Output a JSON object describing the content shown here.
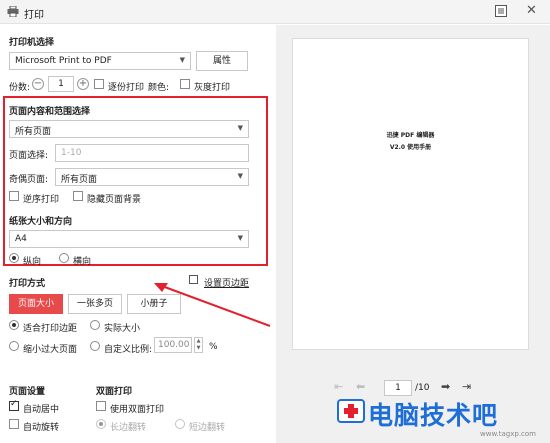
{
  "window": {
    "title": "打印"
  },
  "printer": {
    "section_title": "打印机选择",
    "selected": "Microsoft Print to PDF",
    "properties_label": "属性"
  },
  "copies": {
    "label": "份数:",
    "value": "1",
    "collate_label": "逐份打印",
    "color_label": "颜色:",
    "grayscale_label": "灰度打印"
  },
  "range": {
    "section_title": "页面内容和范围选择",
    "content_selected": "所有页面",
    "page_select_label": "页面选择:",
    "page_select_placeholder": "1-10",
    "odd_even_label": "奇偶页面:",
    "odd_even_selected": "所有页面",
    "reverse_label": "逆序打印",
    "hide_bg_label": "隐藏页面背景"
  },
  "paper": {
    "section_title": "纸张大小和方向",
    "size": "A4",
    "portrait_label": "纵向",
    "landscape_label": "横向"
  },
  "mode": {
    "section_title": "打印方式",
    "margin_link": "设置页边距",
    "tabs": [
      "页面大小",
      "一张多页",
      "小册子"
    ],
    "fit_label": "适合打印边距",
    "actual_label": "实际大小",
    "shrink_label": "缩小过大页面",
    "custom_label": "自定义比例:",
    "custom_value": "100.00",
    "percent": "%"
  },
  "page_settings": {
    "section_title": "页面设置",
    "auto_center": "自动居中",
    "auto_rotate": "自动旋转"
  },
  "duplex": {
    "section_title": "双面打印",
    "use_duplex": "使用双面打印",
    "long_edge": "长边翻转",
    "short_edge": "短边翻转"
  },
  "preview": {
    "doc_title": "迅捷 PDF 编辑器",
    "doc_subtitle": "V2.0 使用手册",
    "current_page": "1",
    "total_pages": "/10"
  },
  "watermark": {
    "text": "电脑技术吧",
    "domain": "www.tagxp.com"
  },
  "colors": {
    "annotation_red": "#e3202e",
    "tab_active": "#e8494a",
    "watermark_blue": "#1e6ed8"
  }
}
